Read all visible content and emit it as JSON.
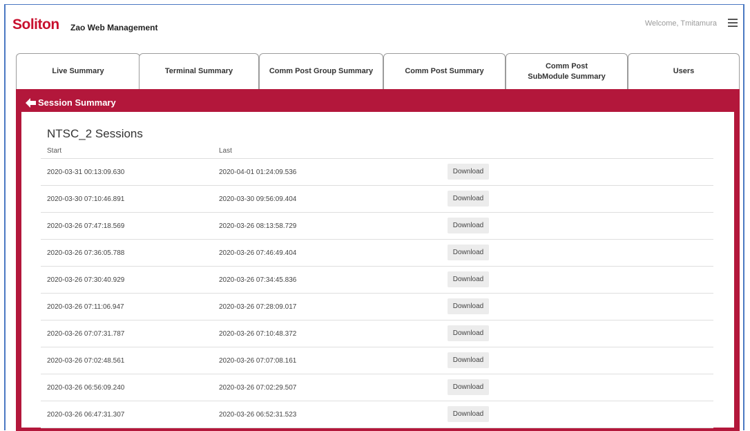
{
  "header": {
    "logo_text": "Soliton",
    "app_title": "Zao Web Management",
    "welcome": "Welcome, Tmitamura",
    "menu_icon": "hamburger-menu-icon"
  },
  "tabs": [
    {
      "label": "Live Summary"
    },
    {
      "label": "Terminal Summary"
    },
    {
      "label": "Comm Post Group Summary"
    },
    {
      "label": "Comm Post Summary"
    },
    {
      "label": "Comm Post SubModule Summary"
    },
    {
      "label": "Users"
    }
  ],
  "panel": {
    "title": "Session Summary",
    "back_icon": "back-arrow-icon",
    "accent_color": "#b3173b"
  },
  "sessions": {
    "title": "NTSC_2 Sessions",
    "col_start": "Start",
    "col_last": "Last",
    "download_label": "Download",
    "rows": [
      {
        "start": "2020-03-31 00:13:09.630",
        "last": "2020-04-01 01:24:09.536"
      },
      {
        "start": "2020-03-30 07:10:46.891",
        "last": "2020-03-30 09:56:09.404"
      },
      {
        "start": "2020-03-26 07:47:18.569",
        "last": "2020-03-26 08:13:58.729"
      },
      {
        "start": "2020-03-26 07:36:05.788",
        "last": "2020-03-26 07:46:49.404"
      },
      {
        "start": "2020-03-26 07:30:40.929",
        "last": "2020-03-26 07:34:45.836"
      },
      {
        "start": "2020-03-26 07:11:06.947",
        "last": "2020-03-26 07:28:09.017"
      },
      {
        "start": "2020-03-26 07:07:31.787",
        "last": "2020-03-26 07:10:48.372"
      },
      {
        "start": "2020-03-26 07:02:48.561",
        "last": "2020-03-26 07:07:08.161"
      },
      {
        "start": "2020-03-26 06:56:09.240",
        "last": "2020-03-26 07:02:29.507"
      },
      {
        "start": "2020-03-26 06:47:31.307",
        "last": "2020-03-26 06:52:31.523"
      }
    ]
  }
}
